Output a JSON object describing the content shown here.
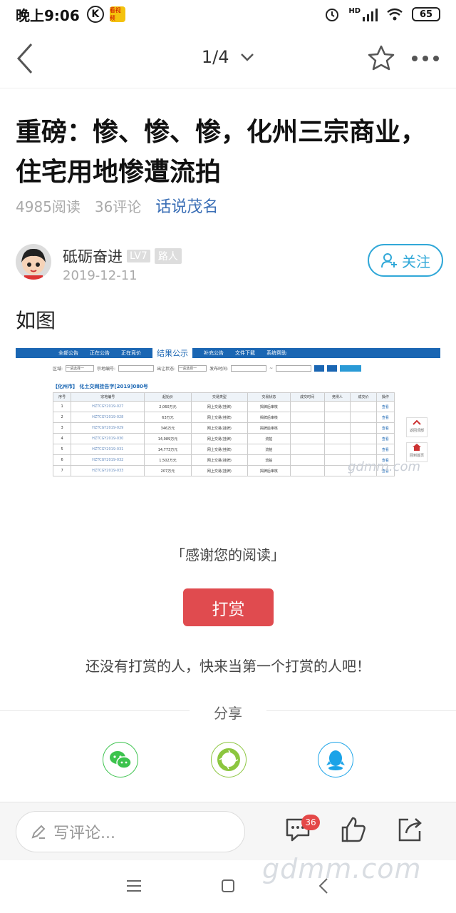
{
  "status_bar": {
    "time": "晚上9:06",
    "k_badge": "K",
    "app_badge": "看视频",
    "signal": "HD",
    "battery": "65"
  },
  "nav": {
    "pager": "1/4"
  },
  "article": {
    "title": "重磅：惨、惨、惨，化州三宗商业，住宅用地惨遭流拍",
    "reads": "4985阅读",
    "comments": "36评论",
    "topic": "话说茂名",
    "author": {
      "name": "砥砺奋进",
      "level": "LV7",
      "role": "路人",
      "date": "2019-12-11",
      "follow_label": "关注"
    },
    "body_text": "如图"
  },
  "embedded": {
    "tabs": [
      "全部公告",
      "正在公告",
      "正在竞价",
      "结果公示",
      "补充公告",
      "文件下载",
      "系统帮助"
    ],
    "active_tab": "结果公示",
    "filter_labels": [
      "区域:",
      "一请选择一",
      "宗地编号:",
      "出让状态:",
      "一请选择一",
      "发布时间:"
    ],
    "table_title": "【化州市】 化土交网挂告字[2019]080号",
    "columns": [
      "序号",
      "宗地编号",
      "起始价",
      "交易类型",
      "交易状态",
      "成交时间",
      "竞得人",
      "成交价",
      "操作"
    ],
    "rows": [
      [
        "1",
        "HZTCGY2019-027",
        "2,060万元",
        "网上交易(挂牌)",
        "揭牌后审核",
        "",
        "",
        "",
        "查看"
      ],
      [
        "2",
        "HZTCGY2019-028",
        "63万元",
        "网上交易(挂牌)",
        "揭牌后审核",
        "",
        "",
        "",
        "查看"
      ],
      [
        "3",
        "HZTCGY2019-029",
        "346万元",
        "网上交易(挂牌)",
        "揭牌后审核",
        "",
        "",
        "",
        "查看"
      ],
      [
        "4",
        "HZTCGY2019-030",
        "14,989万元",
        "网上交易(挂牌)",
        "流拍",
        "",
        "",
        "",
        "查看"
      ],
      [
        "5",
        "HZTCGY2019-031",
        "14,773万元",
        "网上交易(挂牌)",
        "流拍",
        "",
        "",
        "",
        "查看"
      ],
      [
        "6",
        "HZTCGY2019-032",
        "1,502万元",
        "网上交易(挂牌)",
        "流拍",
        "",
        "",
        "",
        "查看"
      ],
      [
        "7",
        "HZTCGY2019-033",
        "207万元",
        "网上交易(挂牌)",
        "揭牌后审核",
        "",
        "",
        "",
        "查看"
      ]
    ],
    "side_buttons": [
      "返回顶部",
      "回到首页"
    ],
    "watermark": "gdmm.com"
  },
  "thanks": "「感谢您的阅读」",
  "reward_label": "打赏",
  "reward_prompt": "还没有打赏的人，快来当第一个打赏的人吧！",
  "share": {
    "title": "分享",
    "items": [
      "wechat-icon",
      "moments-icon",
      "qq-icon"
    ],
    "colors": {
      "wechat": "#3cc34d",
      "moments": "#8cc63f",
      "qq": "#1aa3e8"
    }
  },
  "comment_bar": {
    "placeholder": "写评论...",
    "comment_count": "36"
  },
  "watermark_bottom": "gdmm.com"
}
